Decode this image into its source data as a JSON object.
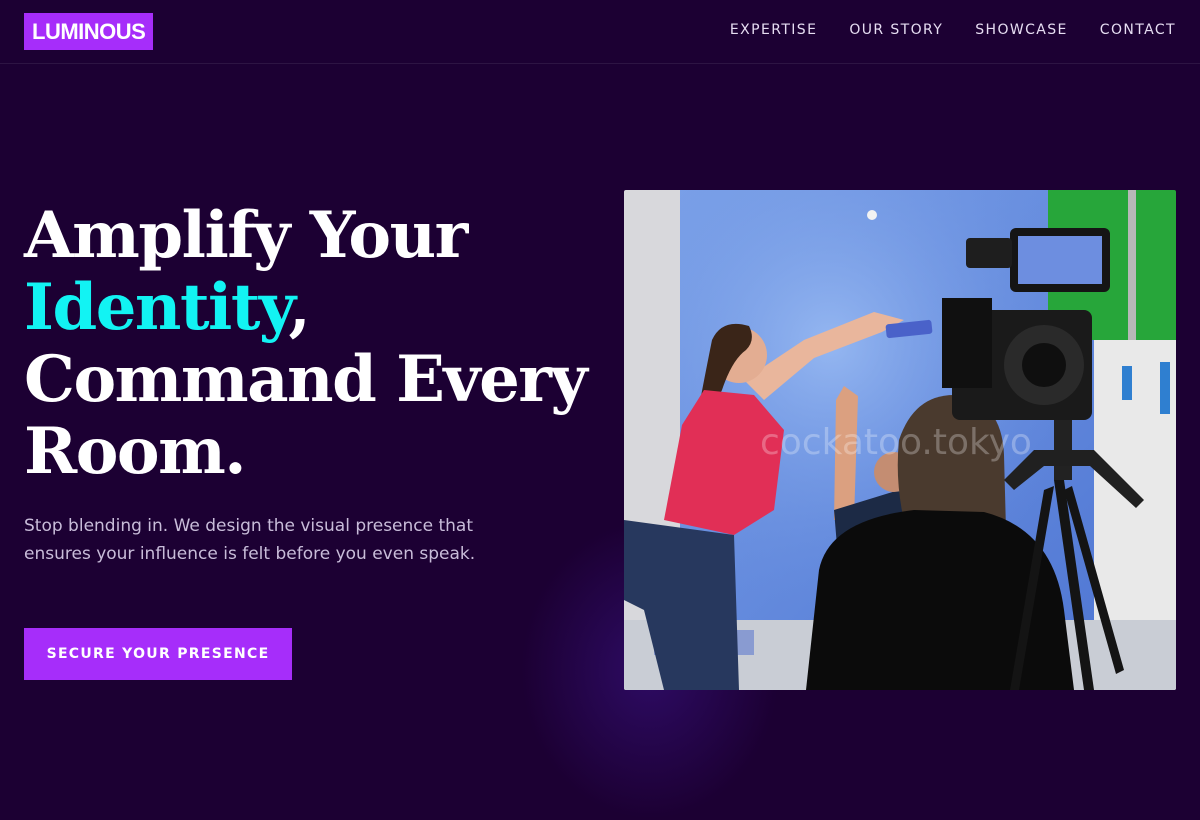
{
  "brand": {
    "logo": "LUMINOUS"
  },
  "nav": {
    "items": [
      "EXPERTISE",
      "OUR STORY",
      "SHOWCASE",
      "CONTACT"
    ]
  },
  "hero": {
    "title_line1": "Amplify Your",
    "title_accent": "Identity",
    "title_comma": ",",
    "title_line3": "Command Every",
    "title_line4": "Room.",
    "subtitle": "Stop blending in. We design the visual presence that ensures your influence is felt before you even speak.",
    "cta_label": "SECURE YOUR PRESENCE"
  },
  "image": {
    "watermark": "cockatoo.tokyo"
  },
  "colors": {
    "background": "#1c0033",
    "accent": "#a62dfa",
    "highlight": "#12f3f3"
  }
}
